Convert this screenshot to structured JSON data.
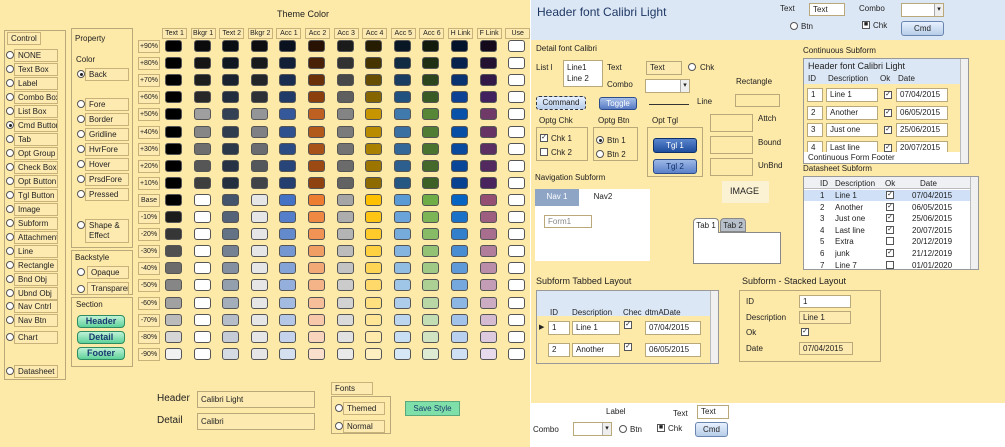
{
  "left": {
    "title": "Theme Color",
    "control_header": "Control",
    "controls": [
      "NONE",
      "Text Box",
      "Label",
      "Combo Box",
      "List Box",
      "Cmd Button",
      "Tab",
      "Opt Group",
      "Check Box",
      "Opt Button",
      "Tgl Button",
      "Image",
      "Subform",
      "Attachment",
      "Line",
      "Rectangle",
      "Bnd Obj",
      "Ubnd Obj",
      "Nav Cntrl",
      "Nav Btn",
      "Chart",
      "Datasheet"
    ],
    "selected_control_index": 5,
    "property_header": "Property",
    "color_header": "Color",
    "colors": [
      "Back",
      "Fore",
      "Border",
      "Gridline",
      "HvrFore",
      "Hover",
      "PrsdFore",
      "Pressed",
      "Shape & Effect"
    ],
    "selected_color_index": 0,
    "backstyle_header": "Backstyle",
    "backstyles": [
      "Opaque",
      "Transparent"
    ],
    "section_header": "Section",
    "sections": [
      "Header",
      "Detail",
      "Footer"
    ],
    "col_headers": [
      "Text 1",
      "Bkgr 1",
      "Text 2",
      "Bkgr 2",
      "Acc 1",
      "Acc 2",
      "Acc 3",
      "Acc 4",
      "Acc 5",
      "Acc 6",
      "H Link",
      "F Link",
      "Use"
    ],
    "row_labels": [
      "+90%",
      "+80%",
      "+70%",
      "+60%",
      "+50%",
      "+40%",
      "+30%",
      "+20%",
      "+10%",
      "Base",
      "-10%",
      "-20%",
      "-30%",
      "-40%",
      "-50%",
      "-60%",
      "-70%",
      "-80%",
      "-90%"
    ],
    "col_colors": [
      "#000000",
      "#262626",
      "#1f2a3a",
      "#2b2f33",
      "#1f3864",
      "#833c0c",
      "#5a5a5a",
      "#7f6000",
      "#1f4e79",
      "#375623",
      "#0b3e8c",
      "#3f1f5a"
    ],
    "col_colors_light": [
      "#f2f2f2",
      "#f2f2f2",
      "#dde3ea",
      "#e7e6e6",
      "#dce6f2",
      "#fbe5d6",
      "#ededed",
      "#fff2cc",
      "#ddebf7",
      "#e2efda",
      "#dbe6f7",
      "#ece2f3"
    ],
    "col_colors_base": [
      "#000000",
      "#ffffff",
      "#44546a",
      "#e7e6e6",
      "#4472c4",
      "#ed7d31",
      "#a5a5a5",
      "#ffc000",
      "#5b9bd5",
      "#70ad47",
      "#0563c1",
      "#954f72"
    ],
    "header_label": "Header",
    "header_font": "Calibri Light",
    "detail_label": "Detail",
    "detail_font": "Calibri",
    "fonts_header": "Fonts",
    "fonts_options": [
      "Themed",
      "Normal"
    ],
    "save_button": "Save Style"
  },
  "right": {
    "header_title": "Header font Calibri Light",
    "text_label": "Text",
    "text_value": "Text",
    "combo_label": "Combo",
    "btn_label": "Btn",
    "chk_label": "Chk",
    "cmd_label": "Cmd",
    "detail_title": "Detail font Calibri",
    "list_label": "List l",
    "list_items": [
      "Line1",
      "Line 2"
    ],
    "text2_label": "Text",
    "text2_value": "Text",
    "chk2_label": "Chk",
    "combo2_label": "Combo",
    "rectangle_label": "Rectangle",
    "command_button": "Command",
    "toggle_button": "Toggle",
    "line_label": "Line",
    "optg_chk_title": "Optg Chk",
    "optg_chk_items": [
      "Chk 1",
      "Chk 2"
    ],
    "optg_btn_title": "Optg Btn",
    "optg_btn_items": [
      "Btn 1",
      "Btn 2"
    ],
    "opt_tgl_title": "Opt Tgl",
    "opt_tgl_items": [
      "Tgl 1",
      "Tgl 2"
    ],
    "attch_label": "Attch",
    "bound_label": "Bound",
    "unbnd_label": "UnBnd",
    "image_label": "IMAGE",
    "nav_title": "Navigation Subform",
    "nav_tabs": [
      "Nav 1",
      "Nav2"
    ],
    "nav_field": "Form1",
    "tabs": [
      "Tab 1",
      "Tab 2"
    ],
    "cont_title": "Continuous Subform",
    "cont_header": "Header font Calibri Light",
    "cont_cols": [
      "ID",
      "Description",
      "Ok",
      "Date"
    ],
    "cont_rows": [
      {
        "id": "1",
        "desc": "Line 1",
        "date": "07/04/2015"
      },
      {
        "id": "2",
        "desc": "Another",
        "date": "06/05/2015"
      },
      {
        "id": "3",
        "desc": "Just one",
        "date": "25/06/2015"
      },
      {
        "id": "4",
        "desc": "Last line",
        "date": "20/07/2015"
      }
    ],
    "cont_footer": "Continuous  Form Footer",
    "ds_title": "Datasheet Subform",
    "ds_cols": [
      "ID",
      "Description",
      "Ok",
      "Date"
    ],
    "ds_rows": [
      {
        "id": "1",
        "desc": "Line 1",
        "ok": true,
        "date": "07/04/2015"
      },
      {
        "id": "2",
        "desc": "Another",
        "ok": true,
        "date": "06/05/2015"
      },
      {
        "id": "3",
        "desc": "Just one",
        "ok": true,
        "date": "25/06/2015"
      },
      {
        "id": "4",
        "desc": "Last line",
        "ok": true,
        "date": "20/07/2015"
      },
      {
        "id": "5",
        "desc": "Extra",
        "ok": false,
        "date": "20/12/2019"
      },
      {
        "id": "6",
        "desc": "junk",
        "ok": true,
        "date": "21/12/2019"
      },
      {
        "id": "7",
        "desc": "Line 7",
        "ok": false,
        "date": "01/01/2020"
      }
    ],
    "tabbed_title": "Subform Tabbed Layout",
    "tabbed_cols": [
      "ID",
      "Description",
      "Chec",
      "dtmADate"
    ],
    "tabbed_rows": [
      {
        "id": "1",
        "desc": "Line 1",
        "date": "07/04/2015"
      },
      {
        "id": "2",
        "desc": "Another",
        "date": "06/05/2015"
      }
    ],
    "stacked_title": "Subform - Stacked Layout",
    "stacked_fields": [
      {
        "label": "ID",
        "value": "1"
      },
      {
        "label": "Description",
        "value": "Line 1"
      },
      {
        "label": "Ok",
        "value": ""
      },
      {
        "label": "Date",
        "value": "07/04/2015"
      }
    ],
    "footer_label": "Label",
    "footer_text_label": "Text",
    "footer_text_value": "Text",
    "footer_combo": "Combo",
    "footer_btn": "Btn",
    "footer_chk": "Chk",
    "footer_cmd": "Cmd"
  }
}
